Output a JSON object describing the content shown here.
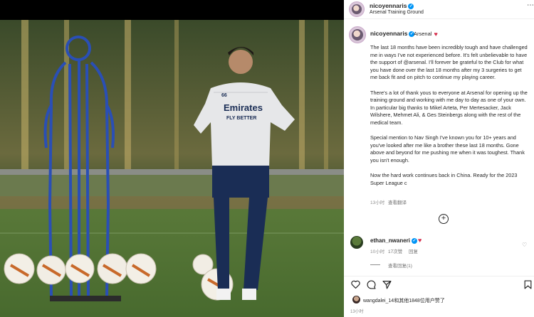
{
  "post": {
    "username": "nicoyennaris",
    "location": "Arsenal Training Ground",
    "caption_author": "nicoyennaris",
    "caption_tag": "Arsenal",
    "paragraphs": [
      "The last 18 months have been incredibly tough and have challenged me in ways I've not experienced before. It's felt unbelievable to have the support of @arsenal. I'll forever be grateful to the Club for what you have done over the last 18 months after my 3 surgeries to get me back fit and on pitch to continue my playing career.",
      "There's a lot of thank yous to everyone at Arsenal for opening up the training ground and working with me day to day as one of your own. In particular big thanks to Mikel Arteta, Per Mertesacker, Jack Wilshere, Mehmet Ali, & Ges Steinbergs along with the rest of the medical team.",
      "Special mention to Nav Singh I've known you for 10+ years and you've looked after me like a brother these last 18 months. Gone above and beyond for me pushing me when it was toughest. Thank you isn't enough.",
      "Now the hard work continues back in China. Ready for the 2023 Super League c"
    ],
    "caption_time": "13小时",
    "see_translation": "查看翻译"
  },
  "comment": {
    "username": "ethan_nwaneri",
    "time": "10小时",
    "likes": "17次赞",
    "reply": "回复",
    "view_replies": "查看回复(1)"
  },
  "footer": {
    "liked_by": "wangdalei_14和其他1848位用户赞了",
    "time": "13小时"
  },
  "photo": {
    "shirt_text": "Emirates",
    "shirt_text2": "FLY BETTER",
    "shirt_number": "66"
  },
  "colors": {
    "verified": "#0095f6",
    "heart": "#d6304d",
    "mannequin": "#2a4fb5"
  }
}
